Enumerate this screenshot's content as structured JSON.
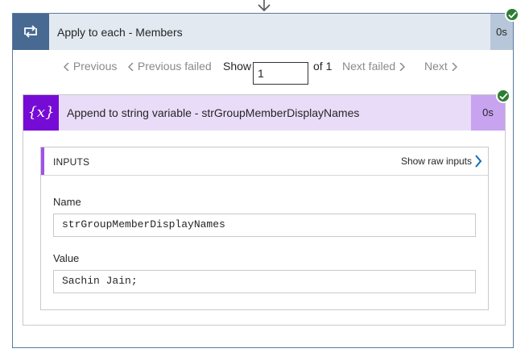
{
  "loop_action": {
    "title": "Apply to each - Members",
    "duration": "0s",
    "icon": "loop-icon",
    "status": "succeeded",
    "header_color": "#e3e9f0",
    "icon_color": "#486991"
  },
  "pager": {
    "previous": "Previous",
    "previous_failed": "Previous failed",
    "show_label": "Show",
    "page_value": "1",
    "of_label": "of 1",
    "next_failed": "Next failed",
    "next": "Next"
  },
  "variable_action": {
    "title": "Append to string variable - strGroupMemberDisplayNames",
    "duration": "0s",
    "icon": "variable-icon",
    "icon_text": "{x}",
    "status": "succeeded",
    "header_color": "#e9dcf8",
    "icon_color": "#770bd6"
  },
  "inputs": {
    "title": "INPUTS",
    "show_raw": "Show raw inputs",
    "fields": [
      {
        "label": "Name",
        "value": "strGroupMemberDisplayNames"
      },
      {
        "label": "Value",
        "value": "Sachin Jain;"
      }
    ]
  }
}
